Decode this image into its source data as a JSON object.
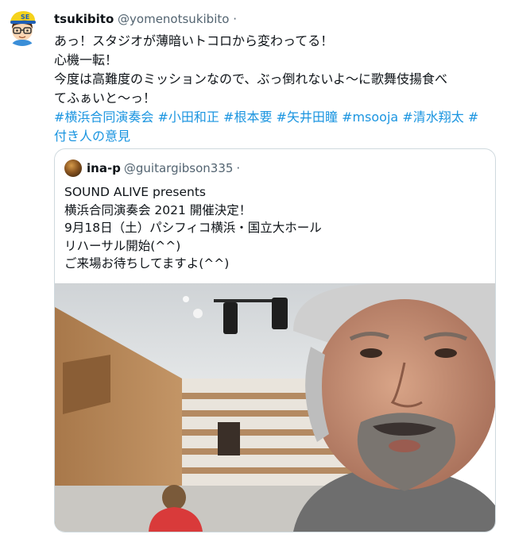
{
  "tweet": {
    "display_name": "tsukibito",
    "handle": "@yomenotsukibito",
    "separator": "·",
    "avatar_label": "SE",
    "text_lines": [
      "あっ！スタジオが薄暗いトコロから変わってる！",
      "心機一転！",
      "今度は高難度のミッションなので、ぶっ倒れないよ～に歌舞伎揚食べ",
      "てふぁいと～っ！"
    ],
    "hashtags_line1": [
      "#横浜合同演奏会",
      "#小田和正",
      "#根本要",
      "#矢井田瞳",
      "#msooja",
      "#清水翔太",
      "#"
    ],
    "hashtags_line2": [
      "付き人の意見"
    ]
  },
  "quote": {
    "display_name": "ina-p",
    "handle": "@guitargibson335",
    "separator": "·",
    "text_lines": [
      "SOUND ALIVE presents",
      "横浜合同演奏会 2021 開催決定！",
      "9月18日（土）パシフィコ横浜・国立大ホール",
      "リハーサル開始(^^)",
      "ご来場お待ちしてますよ(^^)"
    ]
  }
}
